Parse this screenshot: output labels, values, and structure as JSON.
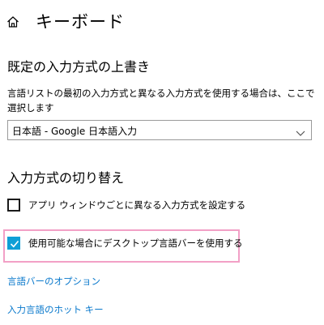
{
  "header": {
    "home_icon": "home-icon",
    "title": "キーボード"
  },
  "override_section": {
    "heading": "既定の入力方式の上書き",
    "description": "言語リストの最初の入力方式と異なる入力方式を使用する場合は、ここで選択します",
    "select": {
      "value": "日本語 - Google 日本語入力",
      "icon": "chevron-down-icon"
    }
  },
  "switch_section": {
    "heading": "入力方式の切り替え",
    "options": [
      {
        "label": "アプリ ウィンドウごとに異なる入力方式を設定する",
        "checked": false
      },
      {
        "label": "使用可能な場合にデスクトップ言語バーを使用する",
        "checked": true
      }
    ],
    "highlight_color": "#f2a0c6",
    "checkbox_accent": "#0f9fd6"
  },
  "links": {
    "language_bar_options": "言語バーのオプション",
    "input_language_hotkeys": "入力言語のホット キー",
    "link_color": "#0a79cc"
  }
}
